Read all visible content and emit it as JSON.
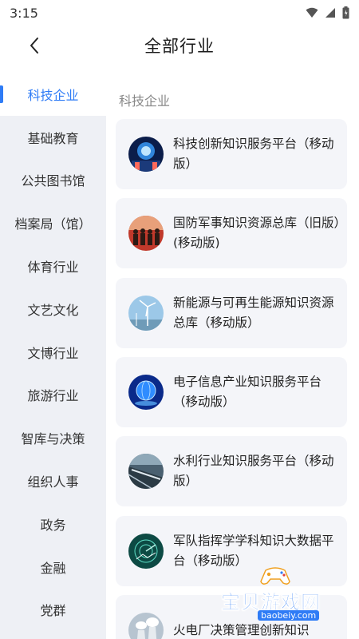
{
  "status_bar": {
    "time": "3:15"
  },
  "header": {
    "title": "全部行业"
  },
  "sidebar": {
    "items": [
      {
        "label": "科技企业",
        "active": true
      },
      {
        "label": "基础教育"
      },
      {
        "label": "公共图书馆"
      },
      {
        "label": "档案局（馆）"
      },
      {
        "label": "体育行业"
      },
      {
        "label": "文艺文化"
      },
      {
        "label": "文博行业"
      },
      {
        "label": "旅游行业"
      },
      {
        "label": "智库与决策"
      },
      {
        "label": "组织人事"
      },
      {
        "label": "政务"
      },
      {
        "label": "金融"
      },
      {
        "label": "党群"
      }
    ]
  },
  "main": {
    "section_title": "科技企业",
    "cards": [
      {
        "title": "科技创新知识服务平台（移动版）",
        "icon": "tech-innovation-thumbnail"
      },
      {
        "title": "国防军事知识资源总库（旧版）(移动版)",
        "icon": "military-soldiers-thumbnail"
      },
      {
        "title": "新能源与可再生能源知识资源总库（移动版）",
        "icon": "wind-turbine-thumbnail"
      },
      {
        "title": "电子信息产业知识服务平台（移动版）",
        "icon": "electronic-globe-thumbnail"
      },
      {
        "title": "水利行业知识服务平台（移动版）",
        "icon": "dam-thumbnail"
      },
      {
        "title": "军队指挥学学科知识大数据平台（移动版）",
        "icon": "command-radar-thumbnail"
      },
      {
        "title": "火电厂决策管理创新知识",
        "icon": "power-plant-thumbnail"
      }
    ]
  },
  "watermark": {
    "text": "宝贝游戏网",
    "url": "baobeiy.com"
  },
  "colors": {
    "accent": "#2f7cf6",
    "sidebar_bg": "#eef0f5",
    "card_bg": "#f4f5f9"
  }
}
